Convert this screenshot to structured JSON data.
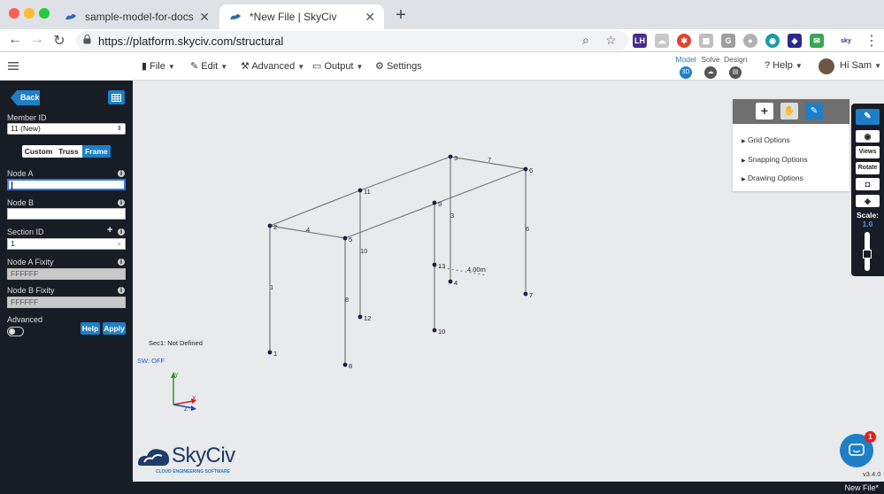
{
  "browser": {
    "tabs": [
      {
        "title": "sample-model-for-docs-concret",
        "active": false
      },
      {
        "title": "*New File | SkyCiv",
        "active": true
      }
    ],
    "url": "https://platform.skyciv.com/structural"
  },
  "toolbar": {
    "menus": [
      "File",
      "Edit",
      "Advanced",
      "Output",
      "Settings"
    ],
    "workflow": [
      "Model",
      "Solve",
      "Design"
    ],
    "help_label": "Help",
    "user_label": "Hi Sam"
  },
  "sidebar": {
    "back_label": "Back",
    "member_id_label": "Member ID",
    "member_id_value": "11 (New)",
    "type_options": [
      "Custom",
      "Truss",
      "Frame"
    ],
    "active_type": "Frame",
    "node_a_label": "Node A",
    "node_a_value": "",
    "node_b_label": "Node B",
    "node_b_value": "",
    "section_id_label": "Section ID",
    "section_id_value": "1",
    "node_a_fixity_label": "Node A Fixity",
    "node_a_fixity_value": "FFFFFF",
    "node_b_fixity_label": "Node B Fixity",
    "node_b_fixity_value": "FFFFFF",
    "advanced_label": "Advanced",
    "help_button": "Help",
    "apply_button": "Apply"
  },
  "canvas": {
    "section_note": "Sec1: Not Defined",
    "sw_status": "SW: OFF",
    "dimension_label": "4.00m",
    "axis_labels": [
      "Y",
      "X",
      "Z"
    ],
    "node_labels": [
      "1",
      "2",
      "3",
      "4",
      "5",
      "6",
      "7",
      "8",
      "9",
      "10",
      "11",
      "12",
      "13"
    ],
    "member_labels": [
      "1",
      "3",
      "4",
      "5",
      "6",
      "7",
      "8",
      "10"
    ]
  },
  "panel": {
    "options": [
      "Grid Options",
      "Snapping Options",
      "Drawing Options"
    ]
  },
  "right_toolbar": {
    "buttons": [
      "Views",
      "Rotate"
    ],
    "scale_label": "Scale:",
    "scale_value": "1.0"
  },
  "logo": {
    "name": "SkyCiv",
    "tagline": "CLOUD ENGINEERING SOFTWARE"
  },
  "chat": {
    "badge": "1"
  },
  "footer": {
    "version": "v3.4.0",
    "file_name": "New File*"
  },
  "colors": {
    "accent": "#1e7fc7",
    "sidebar_bg": "#181d25",
    "canvas_bg": "#e9eaeb",
    "node": "#1b1f4a",
    "badge": "#e02020"
  }
}
